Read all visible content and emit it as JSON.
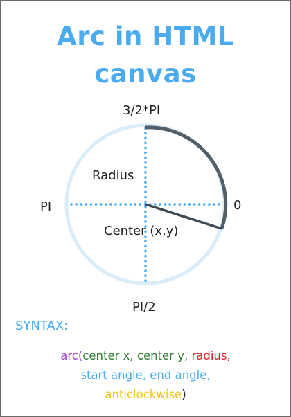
{
  "title": {
    "line1": "Arc in HTML",
    "line2": "canvas"
  },
  "diagram": {
    "label_top": "3/2*PI",
    "label_left": "PI",
    "label_right": "0",
    "label_bottom": "PI/2",
    "label_radius": "Radius",
    "label_center": "Center (x,y)"
  },
  "syntax": {
    "heading": "SYNTAX:",
    "fn": "arc(",
    "center": "center x, center y, ",
    "radius": "radius,",
    "angles": "start angle, end angle,",
    "anticlockwise": "anticlockwise",
    "close": ")"
  },
  "colors": {
    "title": "#4aabef",
    "circle": "#d9ecfa",
    "axis_dots": "#45a9f0",
    "arc": "#515f6b",
    "fn": "#a24ad6",
    "center": "#2e7d32",
    "radius": "#e0202a",
    "angles": "#4aabef",
    "anticlockwise": "#f2c51b"
  }
}
